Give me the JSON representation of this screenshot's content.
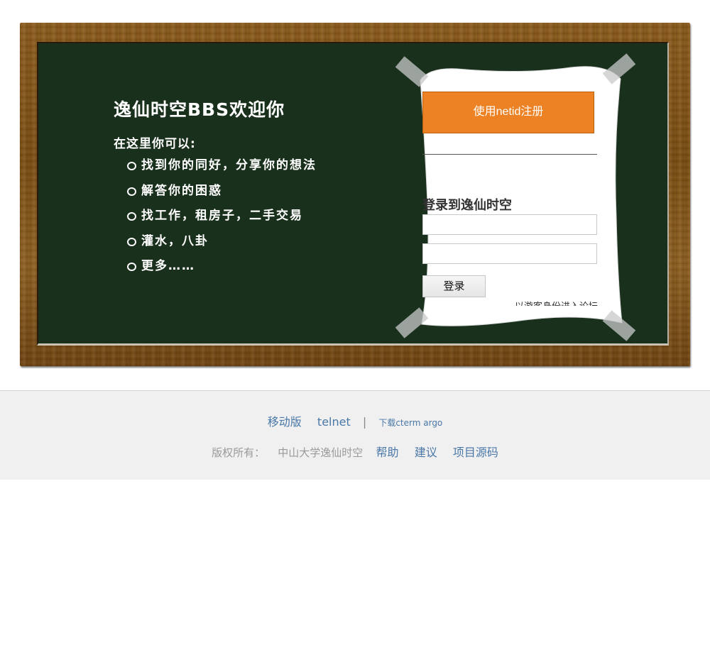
{
  "board": {
    "title": "逸仙时空BBS欢迎你",
    "subtitle": "在这里你可以:",
    "features": [
      "找到你的同好，分享你的想法",
      "解答你的困惑",
      "找工作，租房子，二手交易",
      "灌水，八卦",
      "更多……"
    ]
  },
  "paper": {
    "register_label": "使用netid注册",
    "login_title": "登录到逸仙时空",
    "username_value": "",
    "password_value": "",
    "login_label": "登录",
    "clipped_hint": "无需登录，以游客身份进入论坛"
  },
  "footer": {
    "mobile": "移动版",
    "telnet": "telnet",
    "separator": "|",
    "download": "下载cterm argo",
    "copyright_label": "版权所有：",
    "owner": "中山大学逸仙时空",
    "help": "帮助",
    "suggest": "建议",
    "source": "项目源码"
  },
  "colors": {
    "board": "#19301c",
    "register_button": "#ec8224",
    "link": "#4a78a8"
  }
}
